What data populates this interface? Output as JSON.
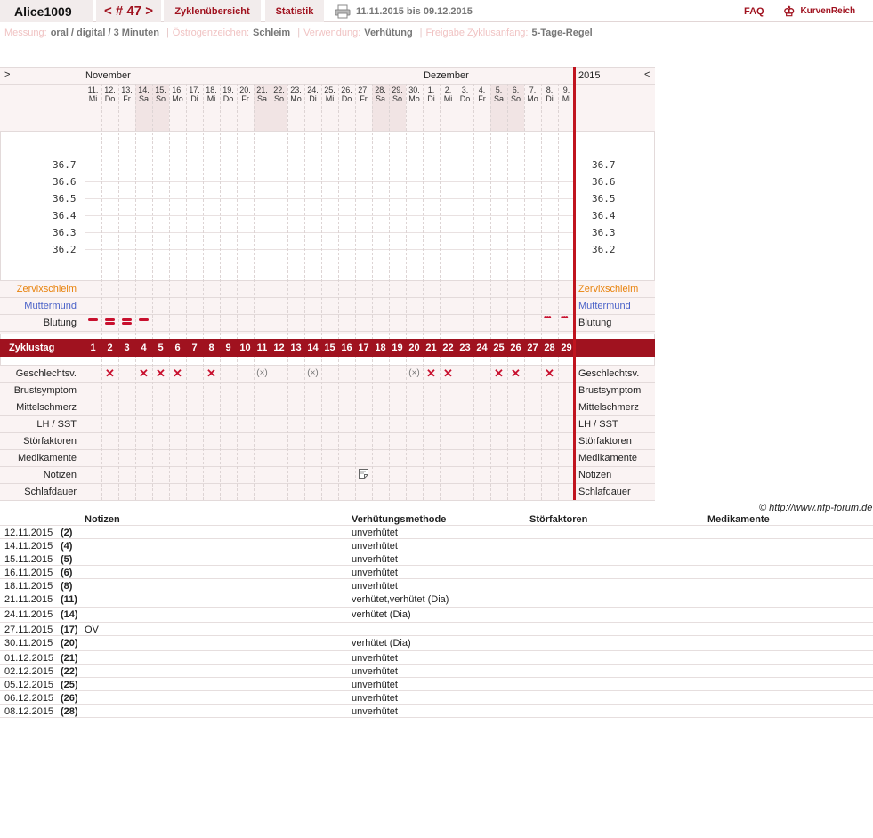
{
  "header": {
    "user": "Alice1009",
    "cycle_nav": "< # 47 >",
    "tabs": [
      "Zyklenübersicht",
      "Statistik"
    ],
    "date_range": "11.11.2015 bis 09.12.2015",
    "faq": "FAQ",
    "logo_text": "KurvenReich",
    "accent_color": "#a0121f"
  },
  "info": [
    {
      "label": "Messung:",
      "value": "oral / digital / 3 Minuten"
    },
    {
      "label": "Östrogenzeichen:",
      "value": "Schleim"
    },
    {
      "label": "Verwendung:",
      "value": "Verhütung"
    },
    {
      "label": "Freigabe Zyklusanfang:",
      "value": "5-Tage-Regel"
    }
  ],
  "chart": {
    "nav_prev": ">",
    "nav_next": "<",
    "month1": "November",
    "month2": "Dezember",
    "year": "2015",
    "days": [
      {
        "d": "11.",
        "w": "Mi",
        "we": false
      },
      {
        "d": "12.",
        "w": "Do",
        "we": false
      },
      {
        "d": "13.",
        "w": "Fr",
        "we": false
      },
      {
        "d": "14.",
        "w": "Sa",
        "we": true
      },
      {
        "d": "15.",
        "w": "So",
        "we": true
      },
      {
        "d": "16.",
        "w": "Mo",
        "we": false
      },
      {
        "d": "17.",
        "w": "Di",
        "we": false
      },
      {
        "d": "18.",
        "w": "Mi",
        "we": false
      },
      {
        "d": "19.",
        "w": "Do",
        "we": false
      },
      {
        "d": "20.",
        "w": "Fr",
        "we": false
      },
      {
        "d": "21.",
        "w": "Sa",
        "we": true
      },
      {
        "d": "22.",
        "w": "So",
        "we": true
      },
      {
        "d": "23.",
        "w": "Mo",
        "we": false
      },
      {
        "d": "24.",
        "w": "Di",
        "we": false
      },
      {
        "d": "25.",
        "w": "Mi",
        "we": false
      },
      {
        "d": "26.",
        "w": "Do",
        "we": false
      },
      {
        "d": "27.",
        "w": "Fr",
        "we": false
      },
      {
        "d": "28.",
        "w": "Sa",
        "we": true
      },
      {
        "d": "29.",
        "w": "So",
        "we": true
      },
      {
        "d": "30.",
        "w": "Mo",
        "we": false
      },
      {
        "d": "1.",
        "w": "Di",
        "we": false
      },
      {
        "d": "2.",
        "w": "Mi",
        "we": false
      },
      {
        "d": "3.",
        "w": "Do",
        "we": false
      },
      {
        "d": "4.",
        "w": "Fr",
        "we": false
      },
      {
        "d": "5.",
        "w": "Sa",
        "we": true
      },
      {
        "d": "6.",
        "w": "So",
        "we": true
      },
      {
        "d": "7.",
        "w": "Mo",
        "we": false
      },
      {
        "d": "8.",
        "w": "Di",
        "we": false
      },
      {
        "d": "9.",
        "w": "Mi",
        "we": false
      }
    ],
    "temps": [
      "36.7",
      "36.6",
      "36.5",
      "36.4",
      "36.3",
      "36.2"
    ],
    "labels": {
      "zervix": "Zervixschleim",
      "muttermund": "Muttermund",
      "blutung": "Blutung",
      "zyklustag": "Zyklustag",
      "geschlechtsv": "Geschlechtsv.",
      "brust": "Brustsymptom",
      "mittel": "Mittelschmerz",
      "lh": "LH / SST",
      "stoer": "Störfaktoren",
      "medi": "Medikamente",
      "notizen": "Notizen",
      "schlaf": "Schlafdauer"
    },
    "label_colors": {
      "zervix": "#e8820c",
      "muttermund": "#4a62c8"
    },
    "bleeding": {
      "heavy": [
        1,
        2,
        3
      ],
      "medium": [
        4
      ],
      "spotting": [
        28,
        29
      ]
    },
    "intercourse_unprotected": [
      2,
      4,
      5,
      6,
      8,
      21,
      22,
      25,
      26,
      28
    ],
    "intercourse_protected": [
      11,
      14,
      20
    ],
    "intercourse_protected_mark": "(×)",
    "intercourse_mark": "✕",
    "note_days": [
      17
    ]
  },
  "copyright": "© http://www.nfp-forum.de",
  "notes_table": {
    "headers": [
      "Notizen",
      "Verhütungsmethode",
      "Störfaktoren",
      "Medikamente"
    ],
    "rows": [
      {
        "date": "12.11.2015",
        "day": "(2)",
        "note": "",
        "method": "unverhütet"
      },
      {
        "date": "14.11.2015",
        "day": "(4)",
        "note": "",
        "method": "unverhütet"
      },
      {
        "date": "15.11.2015",
        "day": "(5)",
        "note": "",
        "method": "unverhütet"
      },
      {
        "date": "16.11.2015",
        "day": "(6)",
        "note": "",
        "method": "unverhütet"
      },
      {
        "date": "18.11.2015",
        "day": "(8)",
        "note": "",
        "method": "unverhütet"
      },
      {
        "date": "21.11.2015",
        "day": "(11)",
        "note": "",
        "method": "verhütet,verhütet (Dia)"
      },
      {
        "date": "24.11.2015",
        "day": "(14)",
        "note": "",
        "method": "verhütet (Dia)"
      },
      {
        "date": "27.11.2015",
        "day": "(17)",
        "note": "OV",
        "method": ""
      },
      {
        "date": "30.11.2015",
        "day": "(20)",
        "note": "",
        "method": "verhütet (Dia)"
      },
      {
        "date": "01.12.2015",
        "day": "(21)",
        "note": "",
        "method": "unverhütet"
      },
      {
        "date": "02.12.2015",
        "day": "(22)",
        "note": "",
        "method": "unverhütet"
      },
      {
        "date": "05.12.2015",
        "day": "(25)",
        "note": "",
        "method": "unverhütet"
      },
      {
        "date": "06.12.2015",
        "day": "(26)",
        "note": "",
        "method": "unverhütet"
      },
      {
        "date": "08.12.2015",
        "day": "(28)",
        "note": "",
        "method": "unverhütet"
      }
    ]
  }
}
